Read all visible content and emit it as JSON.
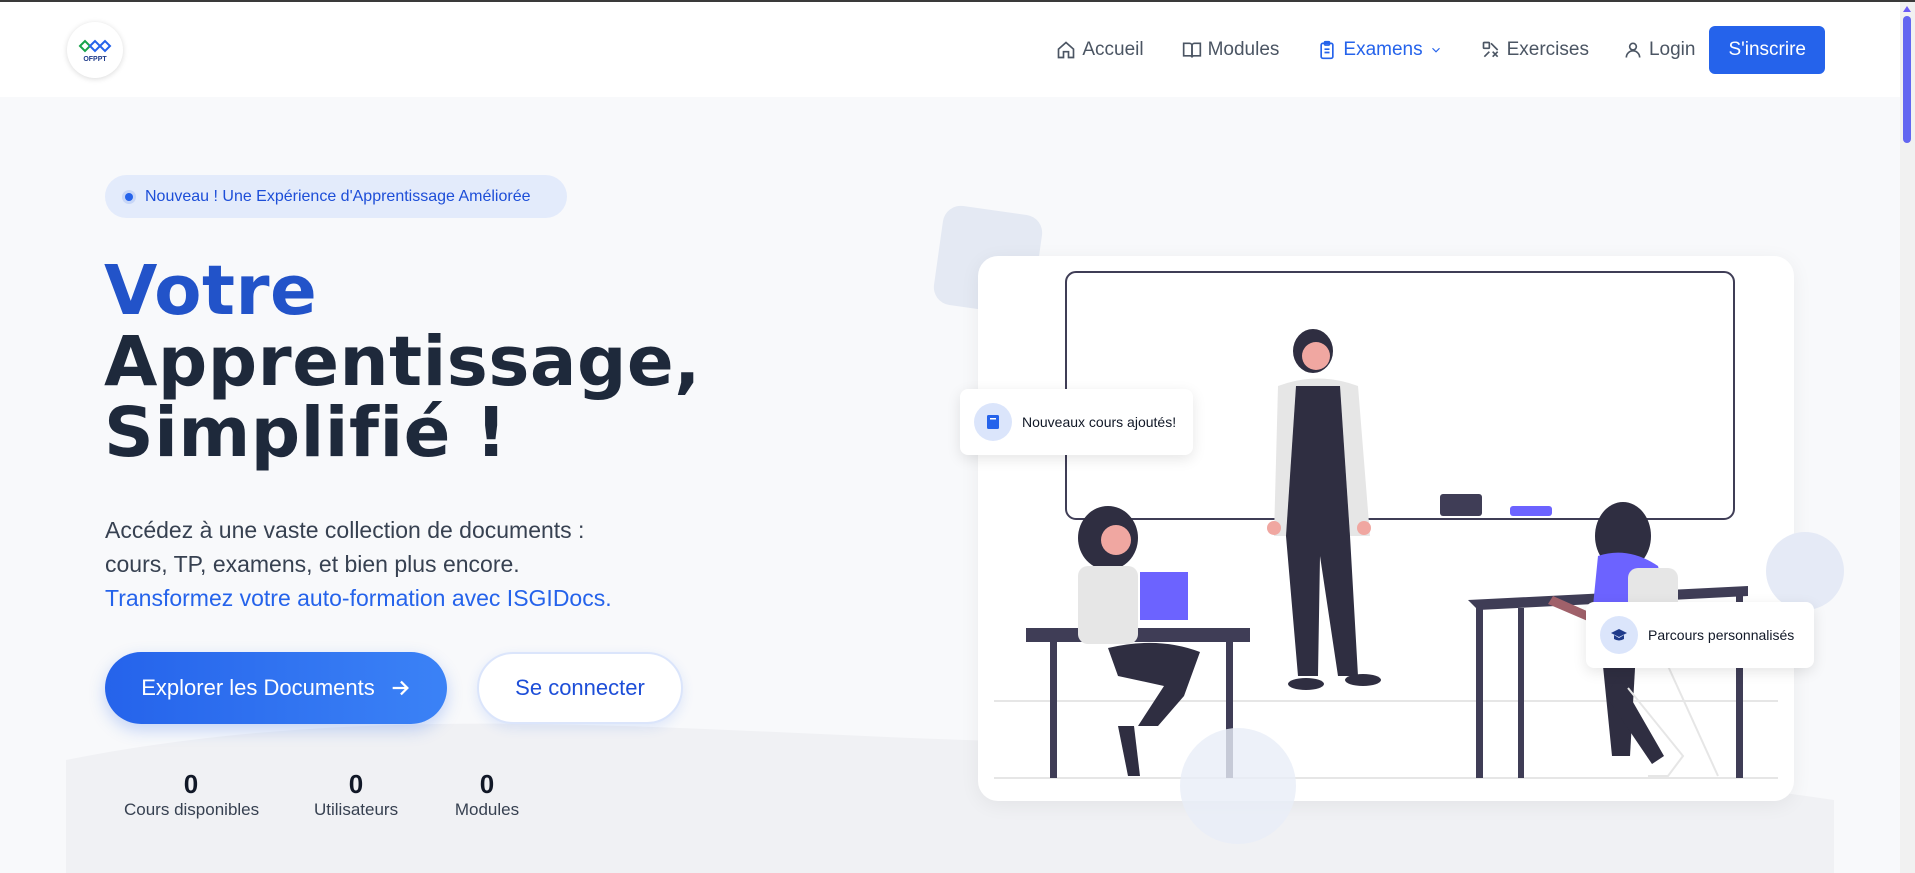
{
  "header": {
    "logo_text": "OFPPT",
    "nav": {
      "home": "Accueil",
      "modules": "Modules",
      "exams": "Examens",
      "exercises": "Exercises",
      "login": "Login"
    },
    "signup_label": "S'inscrire"
  },
  "hero": {
    "badge": "Nouveau ! Une Expérience d'Apprentissage Améliorée",
    "title_line1": "Votre",
    "title_line2": "Apprentissage,",
    "title_line3": "Simplifié !",
    "desc_line1": "Accédez à une vaste collection de documents :",
    "desc_line2": "cours, TP, examens, et bien plus encore.",
    "desc_link": "Transformez votre auto-formation avec ISGIDocs.",
    "cta_primary": "Explorer les Documents",
    "cta_secondary": "Se connecter",
    "stats": [
      {
        "value": "0",
        "label": "Cours disponibles"
      },
      {
        "value": "0",
        "label": "Utilisateurs"
      },
      {
        "value": "0",
        "label": "Modules"
      }
    ]
  },
  "illustration": {
    "float_new_courses": "Nouveaux cours ajoutés!",
    "float_paths": "Parcours personnalisés"
  },
  "colors": {
    "primary": "#2563eb",
    "title_dark": "#1e293b",
    "badge_bg": "#e3ebfb"
  }
}
